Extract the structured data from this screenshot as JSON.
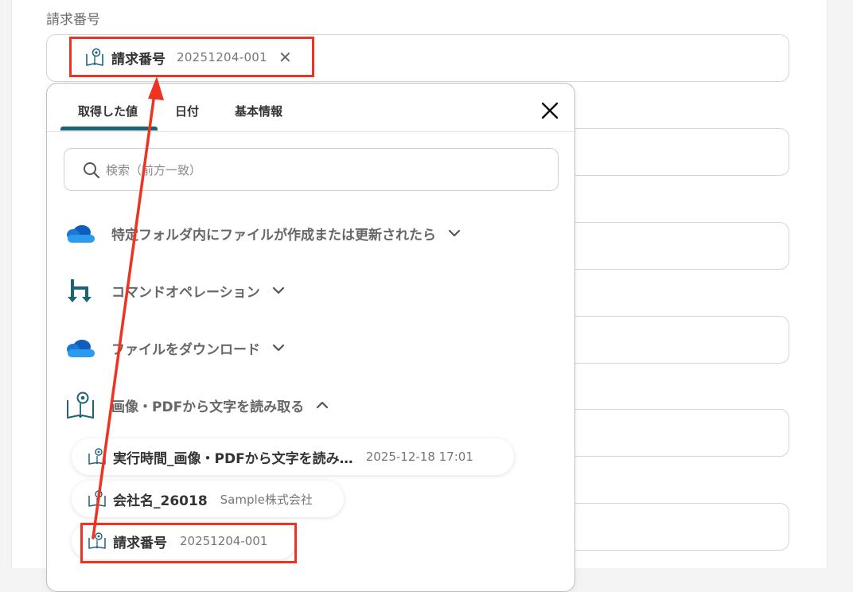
{
  "field": {
    "label": "請求番号",
    "selected_chip": {
      "label": "請求番号",
      "value": "20251204-001"
    }
  },
  "popover": {
    "tabs": [
      {
        "label": "取得した値",
        "active": true
      },
      {
        "label": "日付",
        "active": false
      },
      {
        "label": "基本情報",
        "active": false
      }
    ],
    "search": {
      "placeholder": "検索（前方一致）",
      "value": ""
    },
    "sections": [
      {
        "label": "特定フォルダ内にファイルが作成または更新されたら",
        "icon": "onedrive-icon",
        "expanded": false
      },
      {
        "label": "コマンドオペレーション",
        "icon": "command-operation-icon",
        "expanded": false
      },
      {
        "label": "ファイルをダウンロード",
        "icon": "onedrive-icon",
        "expanded": false
      },
      {
        "label": "画像・PDFから文字を読み取る",
        "icon": "ocr-book-icon",
        "expanded": true
      }
    ],
    "items": [
      {
        "label": "実行時間_画像・PDFから文字を読み…",
        "value": "2025-12-18 17:01"
      },
      {
        "label": "会社名_26018",
        "value": "Sample株式会社"
      },
      {
        "label": "請求番号",
        "value": "20251204-001"
      }
    ]
  },
  "colors": {
    "highlight": "#ee3322",
    "tab_underline": "#1d6378",
    "onedrive_blue": "#1e73d8",
    "command_teal": "#1d6378"
  }
}
